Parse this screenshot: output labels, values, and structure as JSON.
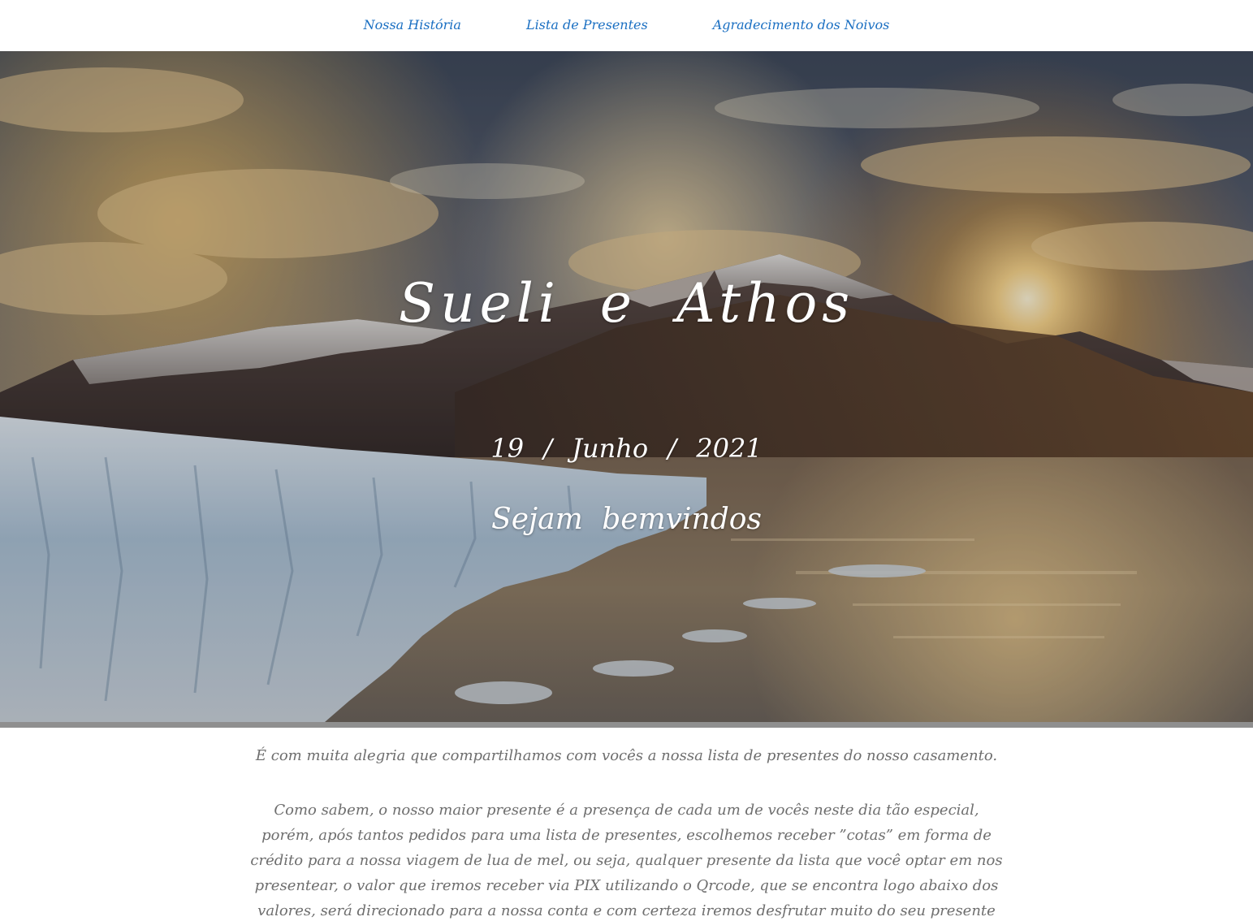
{
  "nav": {
    "items": [
      {
        "label": "Nossa História"
      },
      {
        "label": "Lista de Presentes"
      },
      {
        "label": "Agradecimento dos Noivos"
      }
    ]
  },
  "hero": {
    "names": "Sueli e Athos",
    "date": "19 / Junho / 2021",
    "welcome": "Sejam bemvindos"
  },
  "intro": {
    "line1": "É com muita alegria que compartilhamos com vocês a nossa lista de presentes do nosso casamento.",
    "paragraph": "Como sabem, o nosso maior presente é a presença de cada um de vocês neste dia tão especial, porém, após tantos pedidos para uma lista de presentes, escolhemos receber ”cotas” em forma de crédito para a nossa viagem de lua de mel, ou seja, qualquer presente da lista que você optar em nos presentear, o valor que iremos receber via PIX utilizando o Qrcode, que se encontra logo abaixo dos valores, será direcionado para a nossa conta e com certeza iremos desfrutar muito do seu presente na nossa lua de mel."
  },
  "colors": {
    "nav_link": "#1a6fc2",
    "body_text": "#6e6e6e",
    "hero_text": "#ffffff"
  }
}
